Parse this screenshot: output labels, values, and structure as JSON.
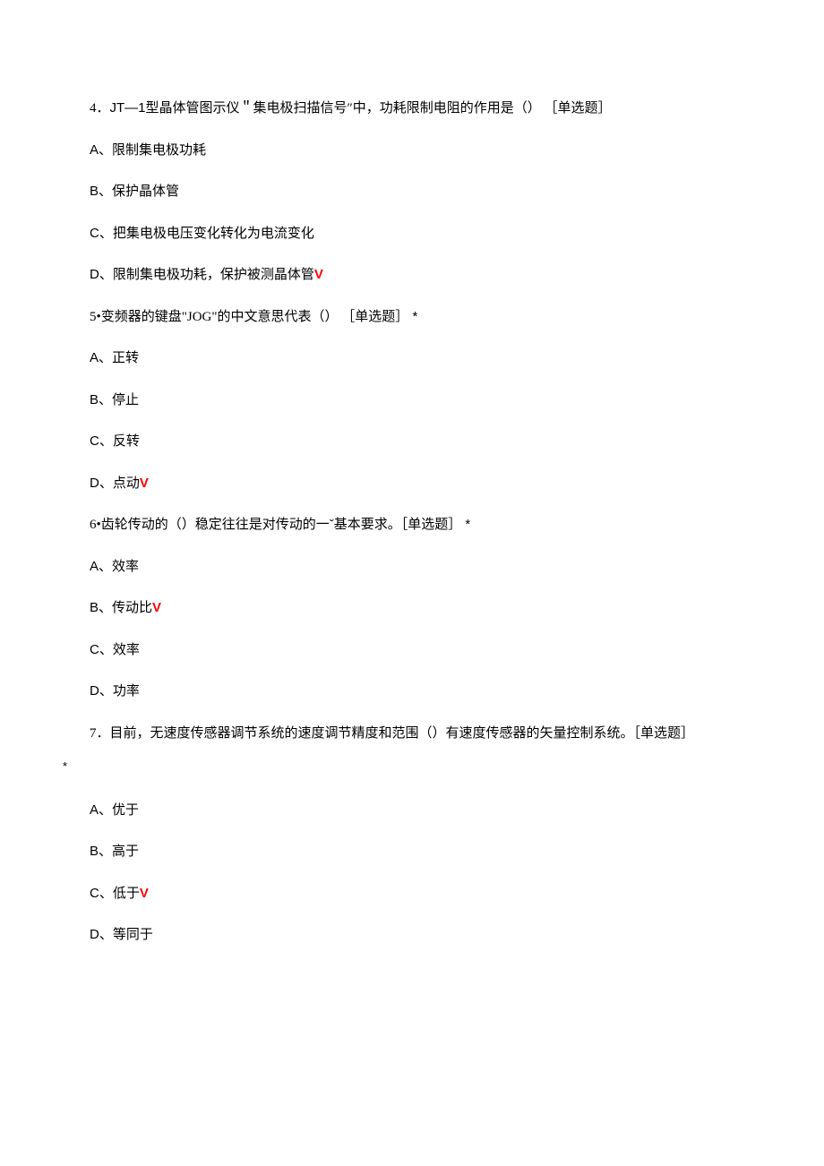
{
  "questions": [
    {
      "num": "4．",
      "latin": "JT—1",
      "text": "型晶体管图示仪＂集电极扫描信号″中，功耗限制电阻的作用是（） ［单选题］",
      "star": "",
      "options": [
        {
          "label": "A",
          "text": "、限制集电极功耗",
          "correct": false
        },
        {
          "label": "B",
          "text": "、保护晶体管",
          "correct": false
        },
        {
          "label": "C",
          "text": "、把集电极电压变化转化为电流变化",
          "correct": false
        },
        {
          "label": "D",
          "text": "、限制集电极功耗，保护被测晶体管",
          "correct": true
        }
      ]
    },
    {
      "num": "5•",
      "latin": "",
      "text": "变频器的键盘\"JOG\"的中文意思代表（） ［单选题］",
      "star": "*",
      "options": [
        {
          "label": "A",
          "text": "、正转",
          "correct": false
        },
        {
          "label": "B",
          "text": "、停止",
          "correct": false
        },
        {
          "label": "C",
          "text": "、反转",
          "correct": false
        },
        {
          "label": "D",
          "text": "、点动",
          "correct": true
        }
      ]
    },
    {
      "num": "6•",
      "latin": "",
      "text": "齿轮传动的（）稳定往往是对传动的一ˇ基本要求。［单选题］",
      "star": "*",
      "options": [
        {
          "label": "A",
          "text": "、效率",
          "correct": false
        },
        {
          "label": "B",
          "text": "、传动比",
          "correct": true
        },
        {
          "label": "C",
          "text": "、效率",
          "correct": false
        },
        {
          "label": "D",
          "text": "、功率",
          "correct": false
        }
      ]
    },
    {
      "num": "7．",
      "latin": "",
      "text": "目前，无速度传感器调节系统的速度调节精度和范围（）有速度传感器的矢量控制系统。［单选题］",
      "star": "",
      "lonestar": "*",
      "options": [
        {
          "label": "A",
          "text": "、优于",
          "correct": false
        },
        {
          "label": "B",
          "text": "、高于",
          "correct": false
        },
        {
          "label": "C",
          "text": "、低于",
          "correct": true
        },
        {
          "label": "D",
          "text": "、等同于",
          "correct": false
        }
      ]
    }
  ],
  "checkmark": "V"
}
